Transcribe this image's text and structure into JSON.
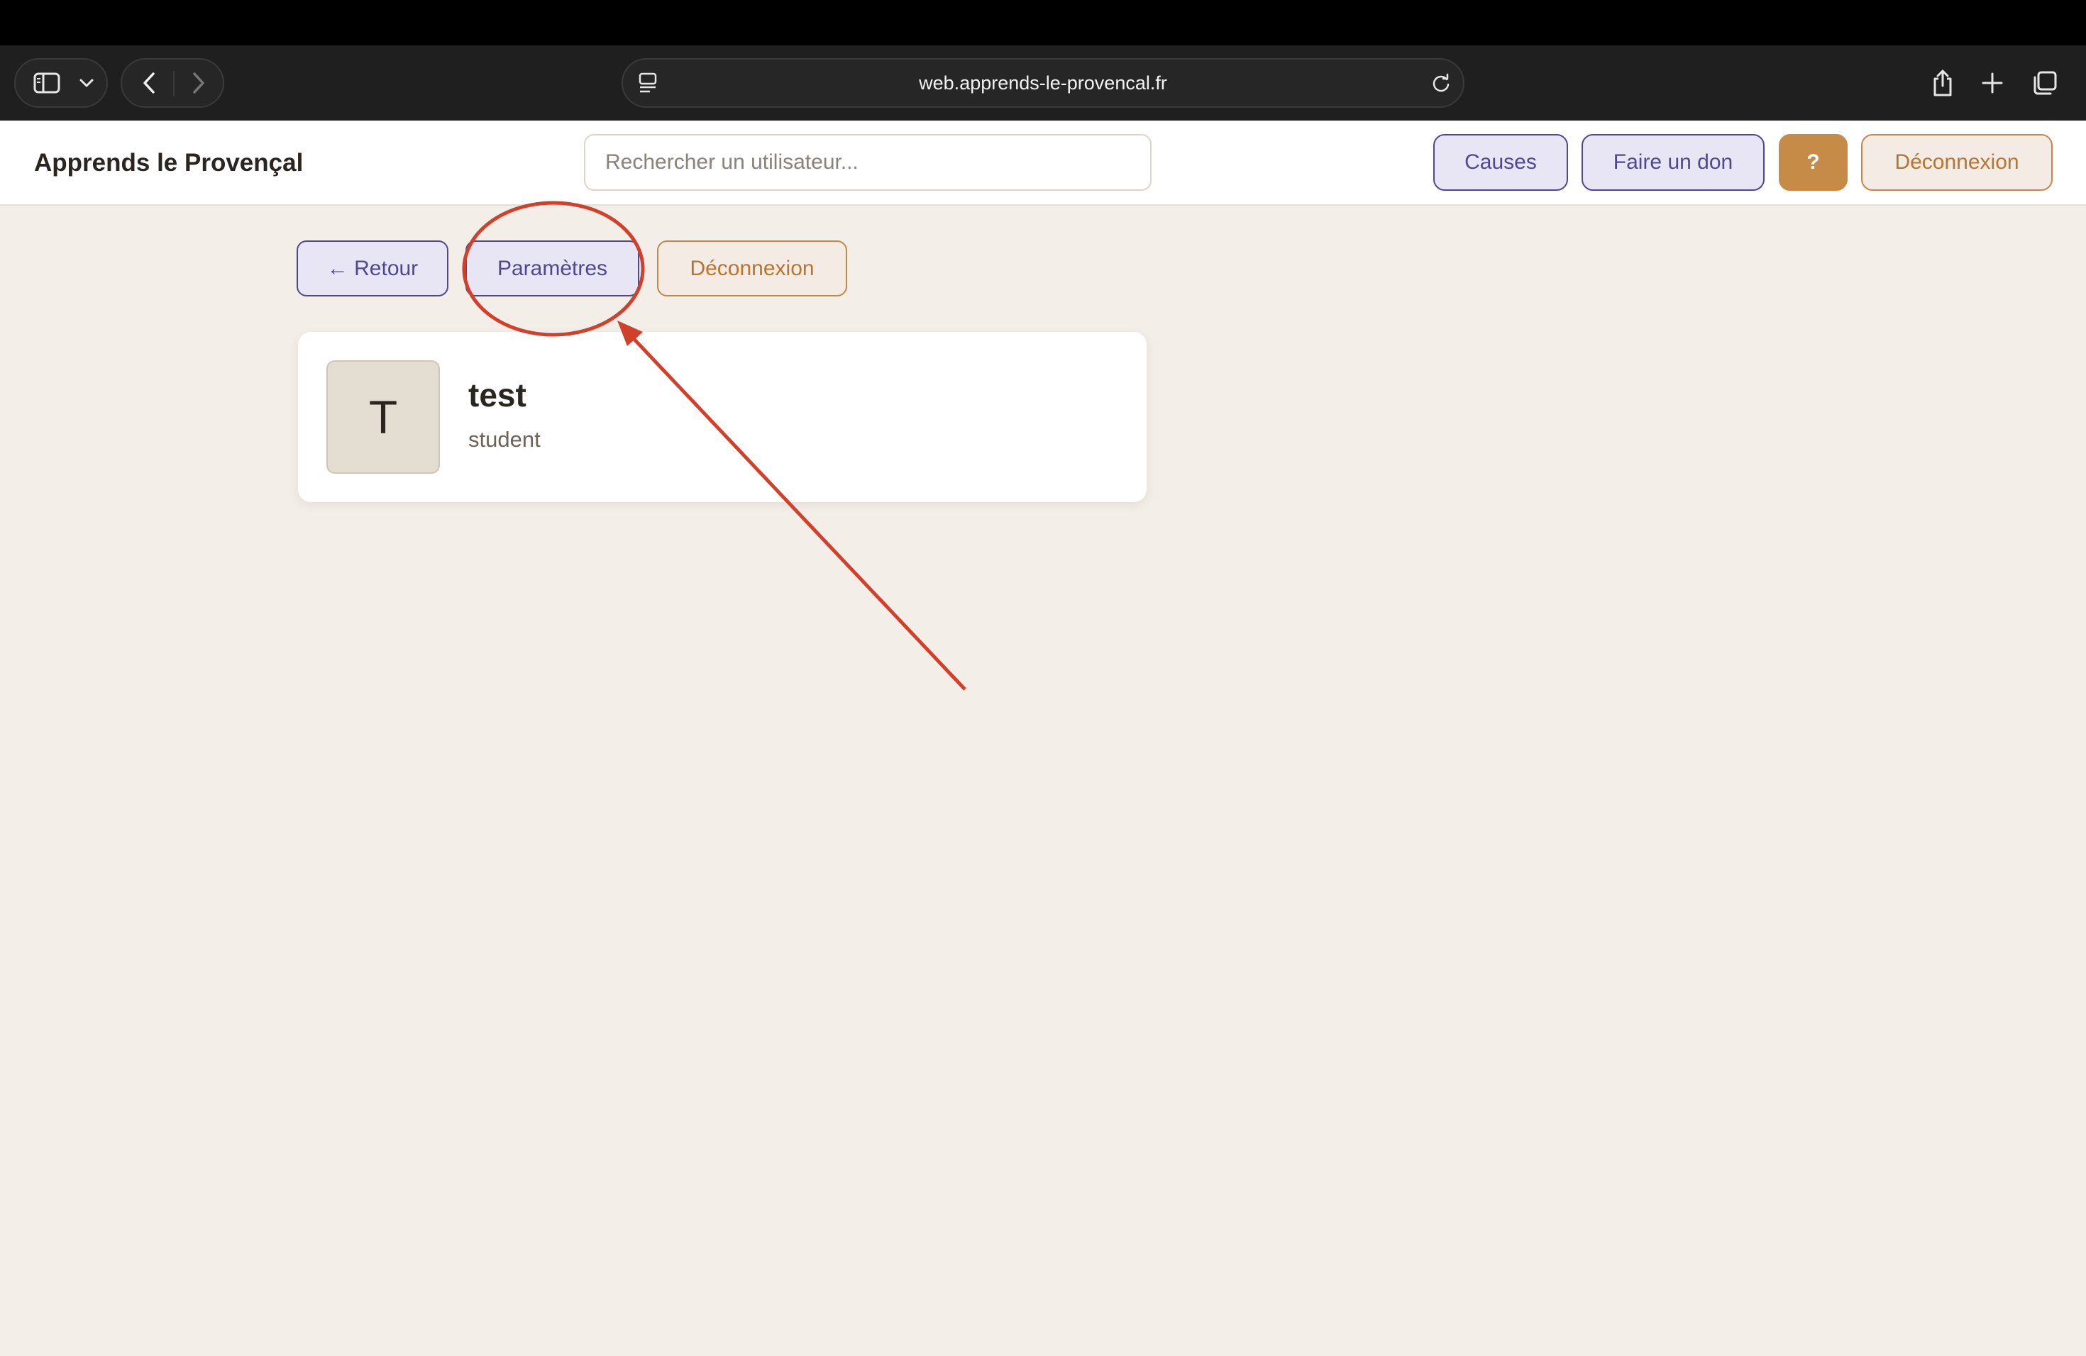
{
  "browser": {
    "url": "web.apprends-le-provencal.fr",
    "icons": [
      "sidebar-icon",
      "chevron-down-icon",
      "back-icon",
      "forward-icon",
      "page-menu-icon",
      "reload-icon",
      "share-icon",
      "new-tab-icon",
      "tabs-overview-icon"
    ]
  },
  "header": {
    "brand": "Apprends le Provençal",
    "search_placeholder": "Rechercher un utilisateur...",
    "causes_label": "Causes",
    "donate_label": "Faire un don",
    "help_label": "?",
    "logout_label": "Déconnexion"
  },
  "actions": {
    "back_label": "← Retour",
    "settings_label": "Paramètres",
    "logout_label": "Déconnexion"
  },
  "profile": {
    "initial": "T",
    "name": "test",
    "role": "student"
  },
  "annotation": {
    "color": "#d0402a",
    "shape": "ellipse-with-arrow",
    "target": "settings-button"
  },
  "colors": {
    "background": "#f3eee7",
    "accent_lavender": "#4f4794",
    "accent_orange": "#c68b47"
  }
}
